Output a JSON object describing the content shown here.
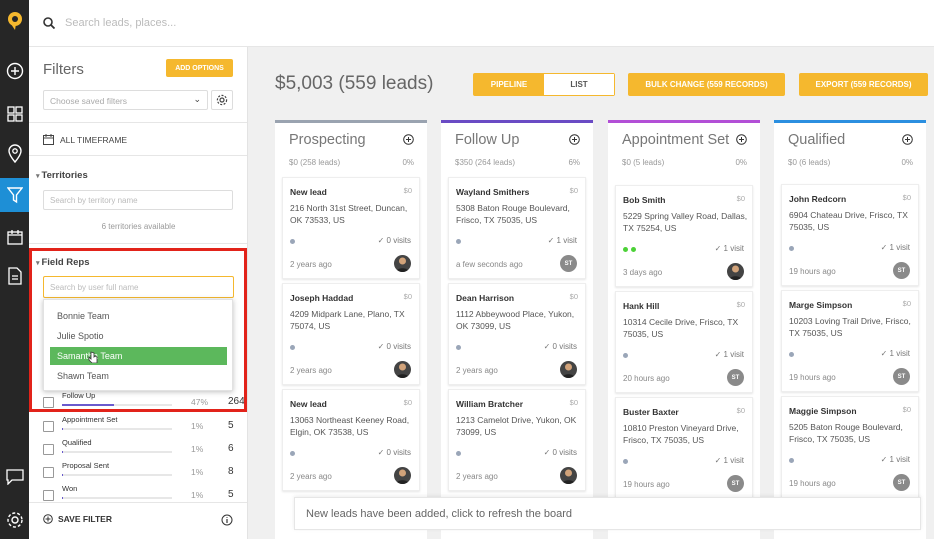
{
  "search": {
    "placeholder": "Search leads, places..."
  },
  "rail": {
    "icons": [
      "logo-icon",
      "plus-circle-icon",
      "grid-icon",
      "map-pin-icon",
      "filter-icon",
      "calendar-icon",
      "document-icon",
      "chat-icon",
      "gear-icon"
    ]
  },
  "filters": {
    "title": "Filters",
    "add_options": "ADD OPTIONS",
    "saved_placeholder": "Choose saved filters",
    "timeframe": "ALL TIMEFRAME",
    "territories": {
      "title": "Territories",
      "placeholder": "Search by territory name",
      "available": "6 territories available"
    },
    "field_reps": {
      "title": "Field Reps",
      "placeholder": "Search by user full name",
      "options": [
        "Bonnie Team",
        "Julie Spotio",
        "Samantha Team",
        "Shawn Team"
      ],
      "selected": "Samantha Team"
    },
    "stages": [
      {
        "name": "Follow Up",
        "pct": "47%",
        "count": "264",
        "fill": 0.47
      },
      {
        "name": "Appointment Set",
        "pct": "1%",
        "count": "5",
        "fill": 0.01
      },
      {
        "name": "Qualified",
        "pct": "1%",
        "count": "6",
        "fill": 0.01
      },
      {
        "name": "Proposal Sent",
        "pct": "1%",
        "count": "8",
        "fill": 0.01
      },
      {
        "name": "Won",
        "pct": "1%",
        "count": "5",
        "fill": 0.01
      }
    ],
    "save_filter": "SAVE FILTER"
  },
  "header": {
    "total": "$5,003 (559 leads)",
    "pipeline": "PIPELINE",
    "list": "LIST",
    "bulk_change": "BULK CHANGE (559 RECORDS)",
    "export": "EXPORT (559 RECORDS)"
  },
  "columns": [
    {
      "title": "Prospecting",
      "summary": "$0 (258 leads)",
      "pct": "0%",
      "color": "#9aa3b0",
      "cards": [
        {
          "name": "New lead",
          "value": "$0",
          "address": "216 North 31st Street, Duncan, OK 73533, US",
          "visits": "0 visits",
          "ago": "2 years ago",
          "avatar": "photo",
          "dots": [
            "grey"
          ]
        },
        {
          "name": "Joseph Haddad",
          "value": "$0",
          "address": "4209 Midpark Lane, Plano, TX 75074, US",
          "visits": "0 visits",
          "ago": "2 years ago",
          "avatar": "photo",
          "dots": [
            "grey"
          ]
        },
        {
          "name": "New lead",
          "value": "$0",
          "address": "13063 Northeast Keeney Road, Elgin, OK 73538, US",
          "visits": "0 visits",
          "ago": "2 years ago",
          "avatar": "photo",
          "dots": [
            "grey"
          ]
        }
      ]
    },
    {
      "title": "Follow Up",
      "summary": "$350 (264 leads)",
      "pct": "6%",
      "color": "#6a4bc4",
      "cards": [
        {
          "name": "Wayland Smithers",
          "value": "$0",
          "address": "5308 Baton Rouge Boulevard, Frisco, TX 75035, US",
          "visits": "1 visit",
          "ago": "a few seconds ago",
          "avatar": "ST",
          "dots": [
            "grey"
          ]
        },
        {
          "name": "Dean Harrison",
          "value": "$0",
          "address": "1112 Abbeywood Place, Yukon, OK 73099, US",
          "visits": "0 visits",
          "ago": "2 years ago",
          "avatar": "photo",
          "dots": [
            "grey"
          ]
        },
        {
          "name": "William Bratcher",
          "value": "$0",
          "address": "1213 Camelot Drive, Yukon, OK 73099, US",
          "visits": "0 visits",
          "ago": "2 years ago",
          "avatar": "photo",
          "dots": [
            "grey"
          ]
        }
      ]
    },
    {
      "title": "Appointment Set",
      "summary": "$0 (5 leads)",
      "pct": "0%",
      "color": "#b24fd6",
      "cards": [
        {
          "name": "Bob Smith",
          "value": "$0",
          "address": "5229 Spring Valley Road, Dallas, TX 75254, US",
          "visits": "1 visit",
          "ago": "3 days ago",
          "avatar": "photo",
          "dots": [
            "green",
            "green"
          ]
        },
        {
          "name": "Hank Hill",
          "value": "$0",
          "address": "10314 Cecile Drive, Frisco, TX 75035, US",
          "visits": "1 visit",
          "ago": "20 hours ago",
          "avatar": "ST",
          "dots": [
            "grey"
          ]
        },
        {
          "name": "Buster Baxter",
          "value": "$0",
          "address": "10810 Preston Vineyard Drive, Frisco, TX 75035, US",
          "visits": "1 visit",
          "ago": "19 hours ago",
          "avatar": "ST",
          "dots": [
            "grey"
          ]
        }
      ]
    },
    {
      "title": "Qualified",
      "summary": "$0 (6 leads)",
      "pct": "0%",
      "color": "#2b8fe0",
      "cards": [
        {
          "name": "John Redcorn",
          "value": "$0",
          "address": "6904 Chateau Drive, Frisco, TX 75035, US",
          "visits": "1 visit",
          "ago": "19 hours ago",
          "avatar": "ST",
          "dots": [
            "grey"
          ]
        },
        {
          "name": "Marge Simpson",
          "value": "$0",
          "address": "10203 Loving Trail Drive, Frisco, TX 75035, US",
          "visits": "1 visit",
          "ago": "19 hours ago",
          "avatar": "ST",
          "dots": [
            "grey"
          ]
        },
        {
          "name": "Maggie Simpson",
          "value": "$0",
          "address": "5205 Baton Rouge Boulevard, Frisco, TX 75035, US",
          "visits": "1 visit",
          "ago": "19 hours ago",
          "avatar": "ST",
          "dots": [
            "grey"
          ]
        }
      ]
    }
  ],
  "toast": "New leads have been added, click to refresh the board",
  "colors": {
    "accent": "#f5b82e",
    "highlight": "#e2231a",
    "selected": "#5cb85c",
    "rail": "#262626",
    "rail_active": "#1e8fd6"
  }
}
